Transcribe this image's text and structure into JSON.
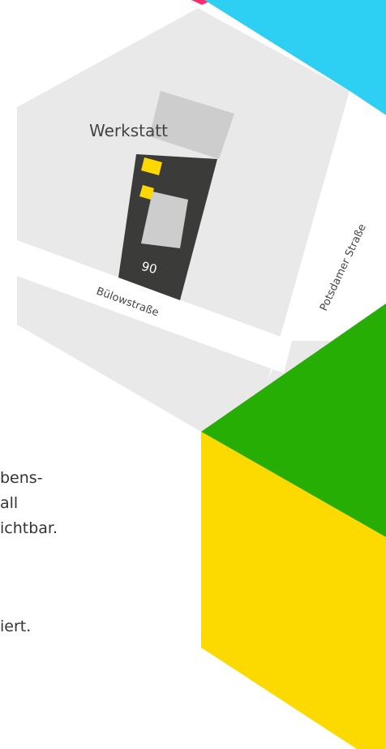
{
  "map": {
    "labels": {
      "building": "Werkstatt",
      "house_number": "90",
      "street_horizontal": "Bülowstraße",
      "street_vertical": "Potsdamer Straße"
    }
  },
  "body_text": {
    "lines": [
      "bens-",
      "all",
      "ichtbar.",
      "iert."
    ]
  },
  "colors": {
    "background": "#ffffff",
    "map_block": "#e9e9e9",
    "street": "#ffffff",
    "building_dark": "#3b3b39",
    "building_light": "#cdcdcd",
    "marker_yellow": "#fcd800",
    "hex_cyan": "#2dcff2",
    "hex_green": "#27ae05",
    "hex_yellow": "#fcda00",
    "hex_magenta": "#ff2a6d",
    "text": "#444444"
  }
}
